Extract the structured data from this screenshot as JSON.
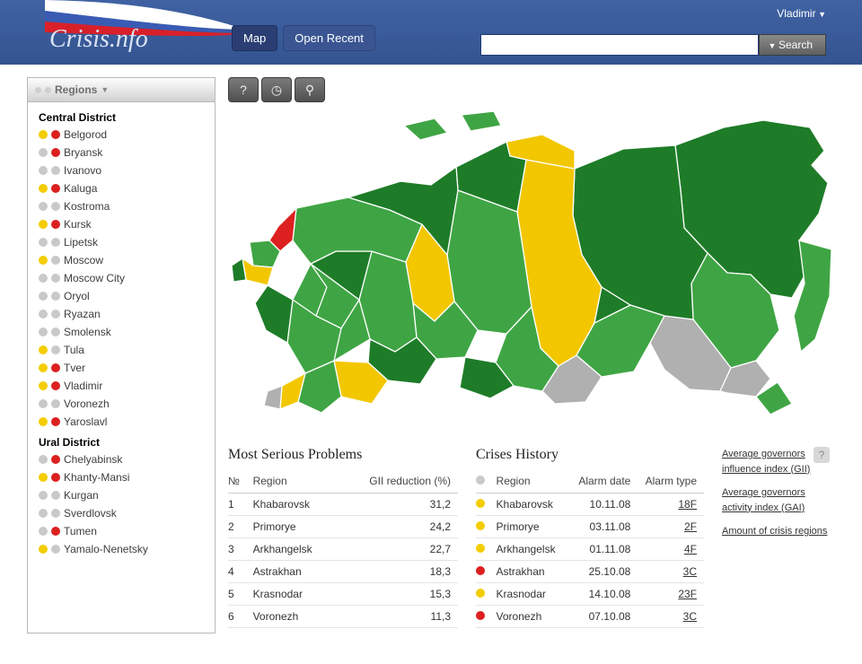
{
  "header": {
    "logo": "Crisis.nfo",
    "nav": {
      "map": "Map",
      "open_recent": "Open Recent"
    },
    "user": "Vladimir",
    "search_btn": "Search",
    "search_placeholder": ""
  },
  "sidebar": {
    "title": "Regions",
    "groups": [
      {
        "name": "Central District",
        "items": [
          {
            "label": "Belgorod",
            "d1": "y",
            "d2": "r"
          },
          {
            "label": "Bryansk",
            "d1": "g",
            "d2": "r"
          },
          {
            "label": "Ivanovo",
            "d1": "g",
            "d2": "g"
          },
          {
            "label": "Kaluga",
            "d1": "y",
            "d2": "r"
          },
          {
            "label": "Kostroma",
            "d1": "g",
            "d2": "g"
          },
          {
            "label": "Kursk",
            "d1": "y",
            "d2": "r"
          },
          {
            "label": "Lipetsk",
            "d1": "g",
            "d2": "g"
          },
          {
            "label": "Moscow",
            "d1": "y",
            "d2": "g"
          },
          {
            "label": "Moscow City",
            "d1": "g",
            "d2": "g"
          },
          {
            "label": "Oryol",
            "d1": "g",
            "d2": "g"
          },
          {
            "label": "Ryazan",
            "d1": "g",
            "d2": "g"
          },
          {
            "label": "Smolensk",
            "d1": "g",
            "d2": "g"
          },
          {
            "label": "Tula",
            "d1": "y",
            "d2": "g"
          },
          {
            "label": "Tver",
            "d1": "y",
            "d2": "r"
          },
          {
            "label": "Vladimir",
            "d1": "y",
            "d2": "r"
          },
          {
            "label": "Voronezh",
            "d1": "g",
            "d2": "g"
          },
          {
            "label": "Yaroslavl",
            "d1": "y",
            "d2": "r"
          }
        ]
      },
      {
        "name": "Ural District",
        "items": [
          {
            "label": "Chelyabinsk",
            "d1": "g",
            "d2": "r"
          },
          {
            "label": "Khanty-Mansi",
            "d1": "y",
            "d2": "r"
          },
          {
            "label": "Kurgan",
            "d1": "g",
            "d2": "g"
          },
          {
            "label": "Sverdlovsk",
            "d1": "g",
            "d2": "g"
          },
          {
            "label": "Tumen",
            "d1": "g",
            "d2": "r"
          },
          {
            "label": "Yamalo-Nenetsky",
            "d1": "y",
            "d2": "g"
          }
        ]
      }
    ]
  },
  "tables": {
    "problems": {
      "title": "Most Serious Problems",
      "cols": [
        "№",
        "Region",
        "GII reduction (%)"
      ],
      "rows": [
        {
          "n": "1",
          "region": "Khabarovsk",
          "val": "31,2"
        },
        {
          "n": "2",
          "region": "Primorye",
          "val": "24,2"
        },
        {
          "n": "3",
          "region": "Arkhangelsk",
          "val": "22,7"
        },
        {
          "n": "4",
          "region": "Astrakhan",
          "val": "18,3"
        },
        {
          "n": "5",
          "region": "Krasnodar",
          "val": "15,3"
        },
        {
          "n": "6",
          "region": "Voronezh",
          "val": "11,3"
        }
      ]
    },
    "history": {
      "title": "Crises History",
      "cols": [
        "",
        "Region",
        "Alarm date",
        "Alarm type"
      ],
      "rows": [
        {
          "dot": "y",
          "region": "Khabarovsk",
          "date": "10.11.08",
          "type": "18F"
        },
        {
          "dot": "y",
          "region": "Primorye",
          "date": "03.11.08",
          "type": "2F"
        },
        {
          "dot": "y",
          "region": "Arkhangelsk",
          "date": "01.11.08",
          "type": "4F"
        },
        {
          "dot": "r",
          "region": "Astrakhan",
          "date": "25.10.08",
          "type": "3C"
        },
        {
          "dot": "y",
          "region": "Krasnodar",
          "date": "14.10.08",
          "type": "23F"
        },
        {
          "dot": "r",
          "region": "Voronezh",
          "date": "07.10.08",
          "type": "3C"
        }
      ]
    },
    "stats": {
      "links": [
        "Average governors influence index (GII)",
        "Average governors activity index (GAI)",
        "Amount of crisis regions"
      ]
    }
  },
  "icons": {
    "help": "?",
    "clock": "◷",
    "magnify": "⚲"
  },
  "colors": {
    "header_bg": "#3a5592",
    "map_green": "#3fa544",
    "map_dark_green": "#1e7c28",
    "map_yellow": "#f2c700",
    "map_red": "#dc2020",
    "map_gray": "#b0b0b0"
  }
}
